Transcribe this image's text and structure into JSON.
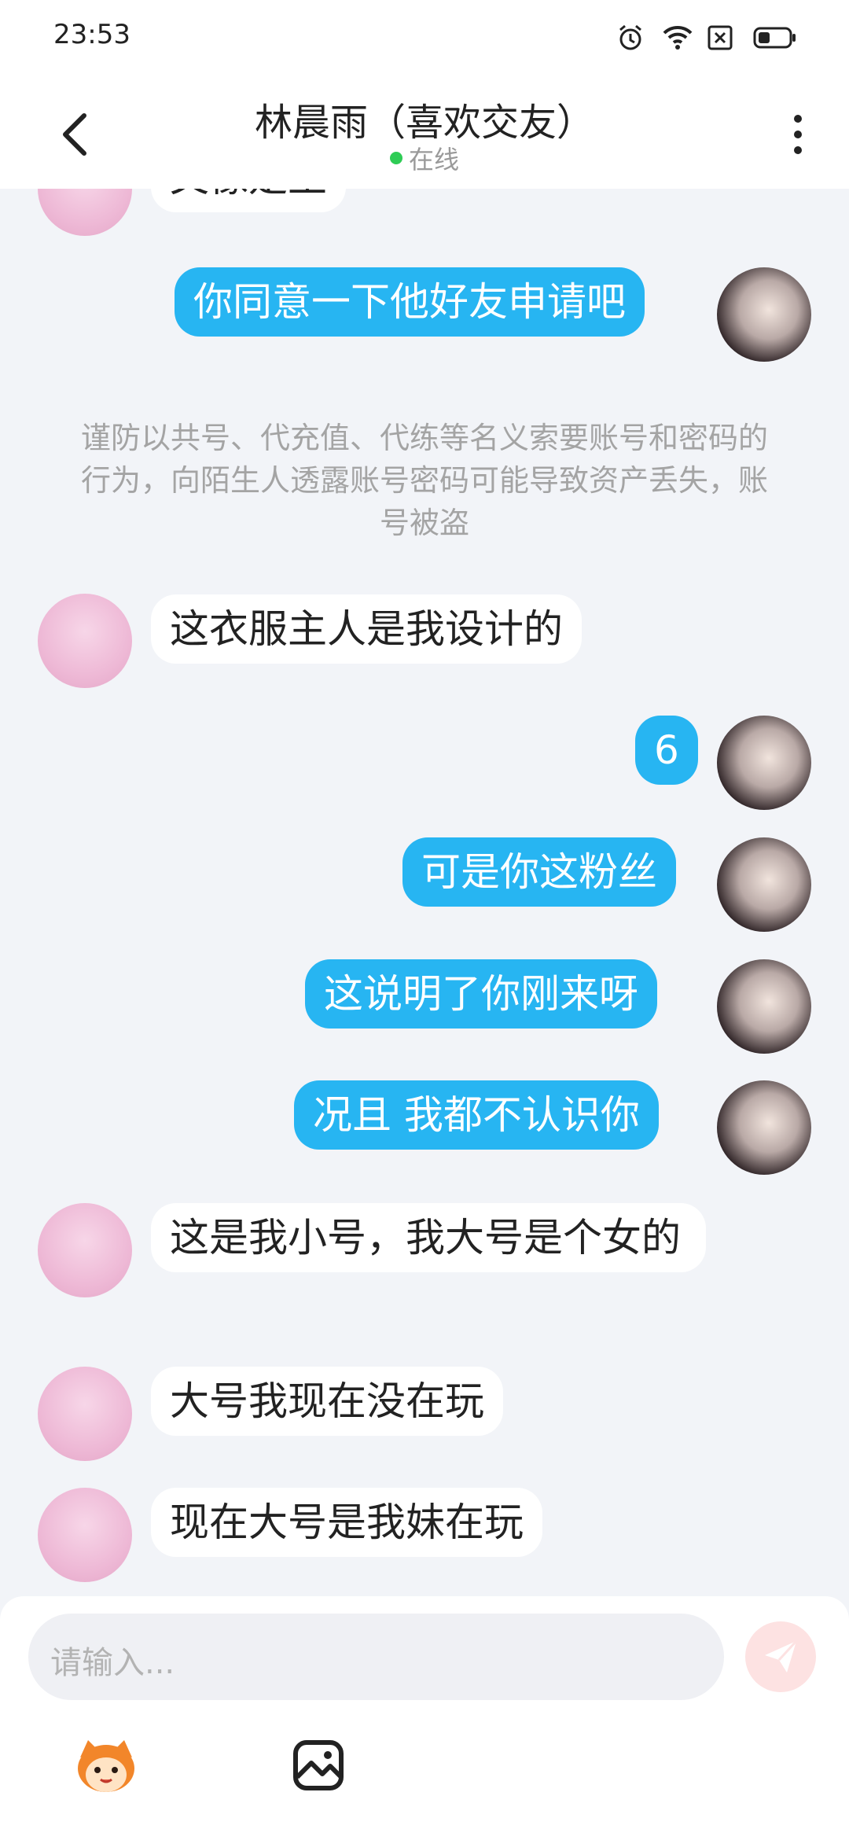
{
  "status_bar": {
    "time": "23:53"
  },
  "header": {
    "title": "林晨雨（喜欢交友）",
    "status": "在线"
  },
  "messages": {
    "m0": "文像是王",
    "m1": "你同意一下他好友申请吧",
    "notice": "谨防以共号、代充值、代练等名义索要账号和密码的行为，向陌生人透露账号密码可能导致资产丢失，账号被盗",
    "m2": "这衣服主人是我设计的",
    "m3": "6",
    "m4": "可是你这粉丝",
    "m5": "这说明了你刚来呀",
    "m6": "况且 我都不认识你",
    "m7": "这是我小号，我大号是个女的",
    "m8": "大号我现在没在玩",
    "m9": "现在大号是我妹在玩"
  },
  "input": {
    "placeholder": "请输入..."
  },
  "colors": {
    "bubble_right": "#27b5f2",
    "online_dot": "#2ecc55",
    "send_button": "#fde2e2"
  },
  "icons": [
    "back-arrow-icon",
    "more-vertical-icon",
    "alarm-icon",
    "wifi-icon",
    "sim-off-icon",
    "battery-icon",
    "send-icon",
    "emoji-mascot-icon",
    "image-icon"
  ]
}
